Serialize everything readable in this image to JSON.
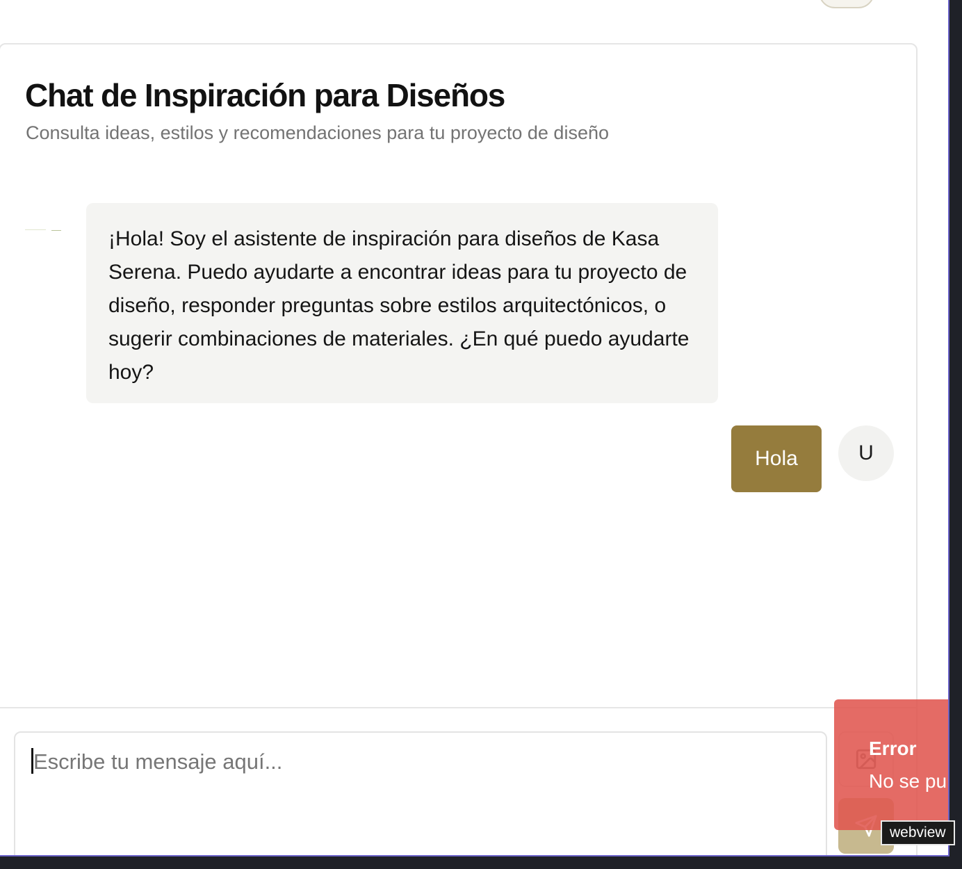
{
  "chat": {
    "title": "Chat de Inspiración para Diseños",
    "subtitle": "Consulta ideas, estilos y recomendaciones para tu proyecto de diseño",
    "messages": [
      {
        "role": "assistant",
        "text": "¡Hola! Soy el asistente de inspiración para diseños de Kasa Serena. Puedo ayudarte a encontrar ideas para tu proyecto de diseño, responder preguntas sobre estilos arquitectónicos, o sugerir combinaciones de materiales. ¿En qué puedo ayudarte hoy?"
      },
      {
        "role": "user",
        "text": "Hola",
        "avatar_initial": "U"
      }
    ]
  },
  "composer": {
    "placeholder": "Escribe tu mensaje aquí...",
    "value": "",
    "image_button_icon": "image-icon",
    "send_button_icon": "send-icon"
  },
  "toast": {
    "title": "Error",
    "description": "No se pu"
  },
  "overlay": {
    "badge": "webview"
  },
  "colors": {
    "accent": "#957c3d",
    "send_disabled": "#c7b98f",
    "error": "#e05650",
    "bubble_bg": "#f4f4f2",
    "frame": "#6b63c9"
  }
}
